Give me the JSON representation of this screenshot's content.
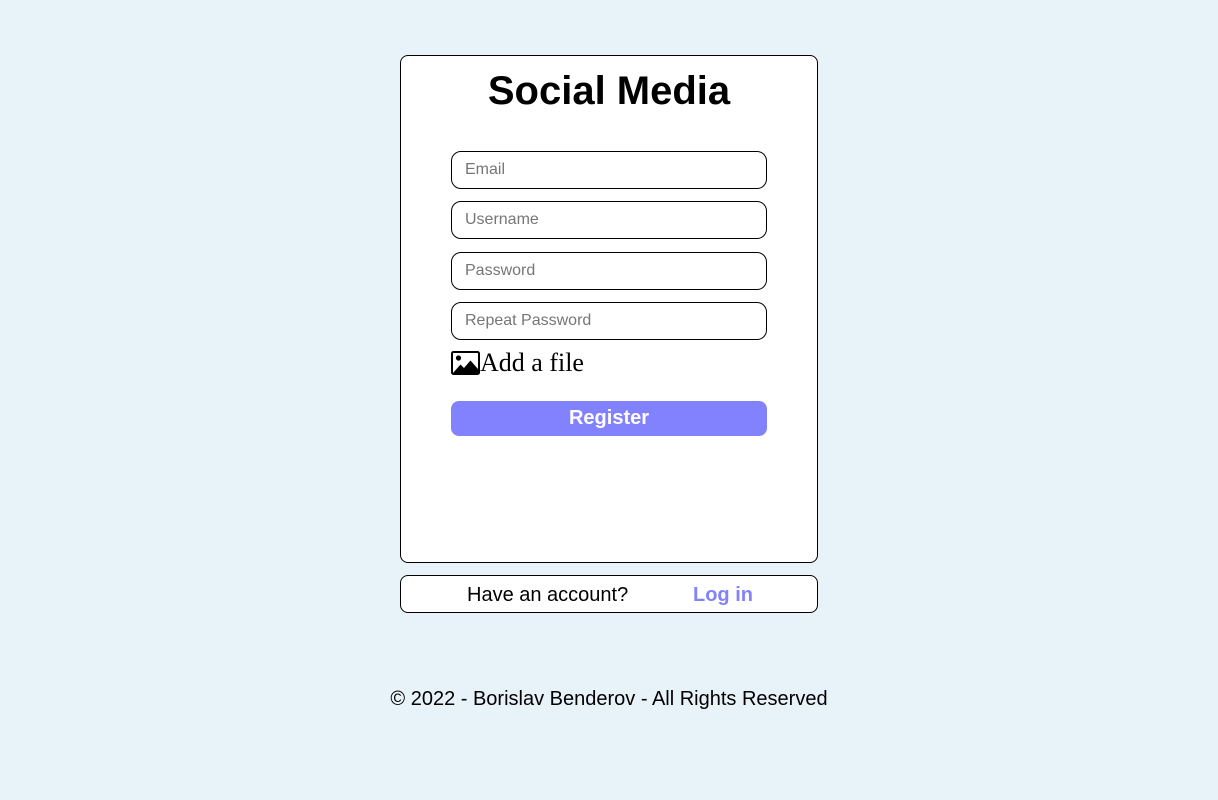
{
  "app": {
    "title": "Social Media"
  },
  "form": {
    "email_placeholder": "Email",
    "username_placeholder": "Username",
    "password_placeholder": "Password",
    "repeat_password_placeholder": "Repeat Password",
    "file_label": "Add a file",
    "file_icon": "image-icon",
    "register_label": "Register"
  },
  "login": {
    "prompt": "Have an account?",
    "link_label": "Log in"
  },
  "footer": {
    "text": "© 2022 - Borislav Benderov - All Rights Reserved"
  },
  "colors": {
    "background": "#e8f3f9",
    "accent": "#8282ff",
    "card": "#ffffff"
  }
}
